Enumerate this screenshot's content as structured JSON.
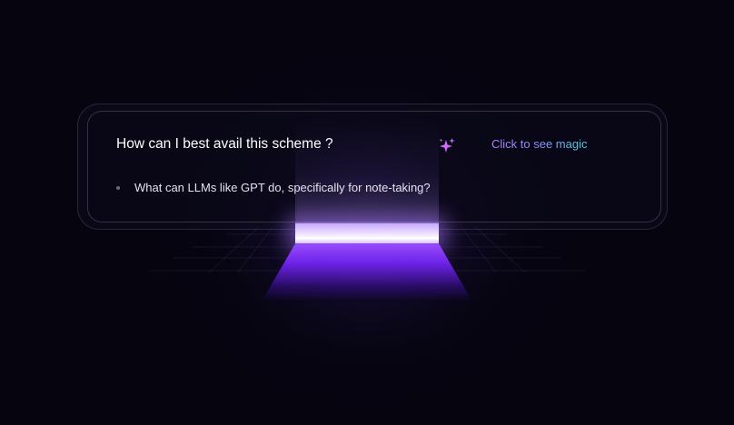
{
  "card": {
    "question": "How can I best avail this scheme ?",
    "action_label": "Click to see magic",
    "suggestions": [
      "What can LLMs like GPT do, specifically for note-taking?"
    ]
  },
  "icons": {
    "sparkle": "sparkle-icon"
  },
  "colors": {
    "background": "#06040f",
    "beam_core": "#ffffff",
    "beam_glow": "#9a4dff",
    "action_gradient_start": "#b77cff",
    "action_gradient_end": "#49d3e0",
    "sparkle": "#e066ff"
  }
}
